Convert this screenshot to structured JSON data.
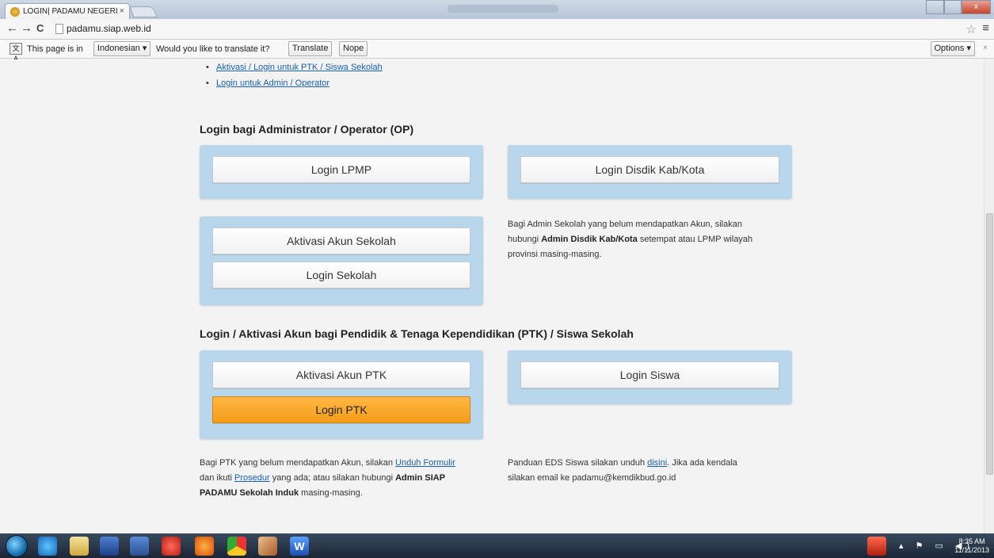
{
  "browser": {
    "tab_title": "LOGIN| PADAMU NEGERI",
    "tab_close": "×",
    "url": "padamu.siap.web.id",
    "back": "←",
    "forward": "→",
    "reload": "C",
    "star": "☆",
    "menu": "≡",
    "win_close": "x"
  },
  "translate_bar": {
    "icon": "文A",
    "prefix": "This page is in",
    "language": "Indonesian ▾",
    "question": "Would you like to translate it?",
    "translate_btn": "Translate",
    "nope_btn": "Nope",
    "options_btn": "Options ▾",
    "close": "×"
  },
  "top_links": [
    "Aktivasi / Login untuk PTK / Siswa Sekolah",
    "Login untuk Admin / Operator"
  ],
  "admin_section": {
    "heading": "Login bagi Administrator / Operator (OP)",
    "login_lpmp": "Login LPMP",
    "login_disdik": "Login Disdik Kab/Kota",
    "aktivasi_sekolah": "Aktivasi Akun Sekolah",
    "login_sekolah": "Login Sekolah",
    "note_1": "Bagi Admin Sekolah yang belum mendapatkan Akun, silakan",
    "note_2a": "hubungi",
    "note_2b": "Admin Disdik Kab/Kota",
    "note_2c": "setempat atau LPMP wilayah",
    "note_3": "provinsi masing-masing."
  },
  "ptk_section": {
    "heading": "Login / Aktivasi Akun bagi Pendidik & Tenaga Kependidikan (PTK) / Siswa Sekolah",
    "aktivasi_ptk": "Aktivasi Akun PTK",
    "login_ptk": "Login PTK",
    "login_siswa": "Login Siswa",
    "ptk_note_1a": "Bagi PTK yang belum mendapatkan Akun, silakan",
    "ptk_note_1b": "Unduh Formulir",
    "ptk_note_2a": "dan ikuti",
    "ptk_note_2b": "Prosedur",
    "ptk_note_2c": "yang ada; atau silakan hubungi",
    "ptk_note_2d": "Admin SIAP",
    "ptk_note_3a": "PADAMU Sekolah Induk",
    "ptk_note_3b": "masing-masing.",
    "siswa_note_1a": "Panduan EDS Siswa silakan unduh",
    "siswa_note_1b": "disini",
    "siswa_note_1c": ". Jika ada kendala",
    "siswa_note_2": "silakan email ke padamu@kemdikbud.go.id"
  },
  "taskbar": {
    "time": "8:35 AM",
    "date": "11/11/2013",
    "tray_icons": "▴ ⚑ ▭ ◀)"
  },
  "colors": {
    "panel": "#b9d7ec",
    "accent_orange": "#f39c17",
    "link": "#1a5fb4"
  }
}
